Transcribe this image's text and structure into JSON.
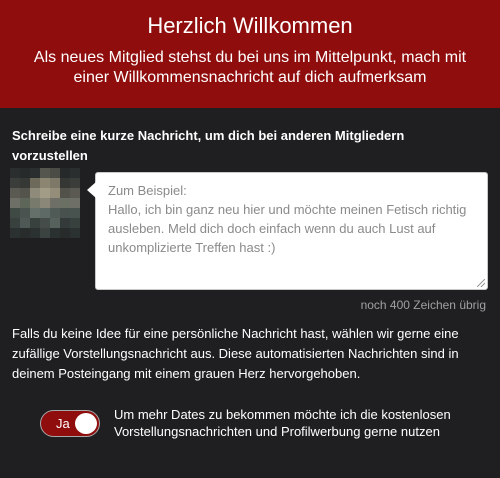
{
  "header": {
    "title": "Herzlich Willkommen",
    "subtitle": "Als neues Mitglied stehst du bei uns im Mittelpunkt, mach mit einer Willkommensnachricht auf dich aufmerksam"
  },
  "intro": {
    "prompt": "Schreibe eine kurze Nachricht, um dich bei anderen Mitgliedern vorzustellen"
  },
  "message": {
    "placeholder": "Zum Beispiel:\nHallo, ich bin ganz neu hier und möchte meinen Fetisch richtig ausleben. Meld dich doch einfach wenn du auch Lust auf unkomplizierte Treffen hast :)",
    "value": "",
    "counter": "noch 400 Zeichen übrig"
  },
  "info_text": "Falls du keine Idee für eine persönliche Nachricht hast, wählen wir gerne eine zufällige Vorstellungsnachricht aus. Diese automatisierten Nachrichten sind in deinem Posteingang mit einem grauen Herz hervorgehoben.",
  "consent": {
    "toggle_label": "Ja",
    "toggle_state": "on",
    "text": "Um mehr Dates zu bekommen möchte ich die kostenlosen Vorstellungsnachrichten und Profilwerbung gerne nutzen"
  },
  "colors": {
    "accent": "#8f0d0d",
    "background": "#1f1f21"
  }
}
